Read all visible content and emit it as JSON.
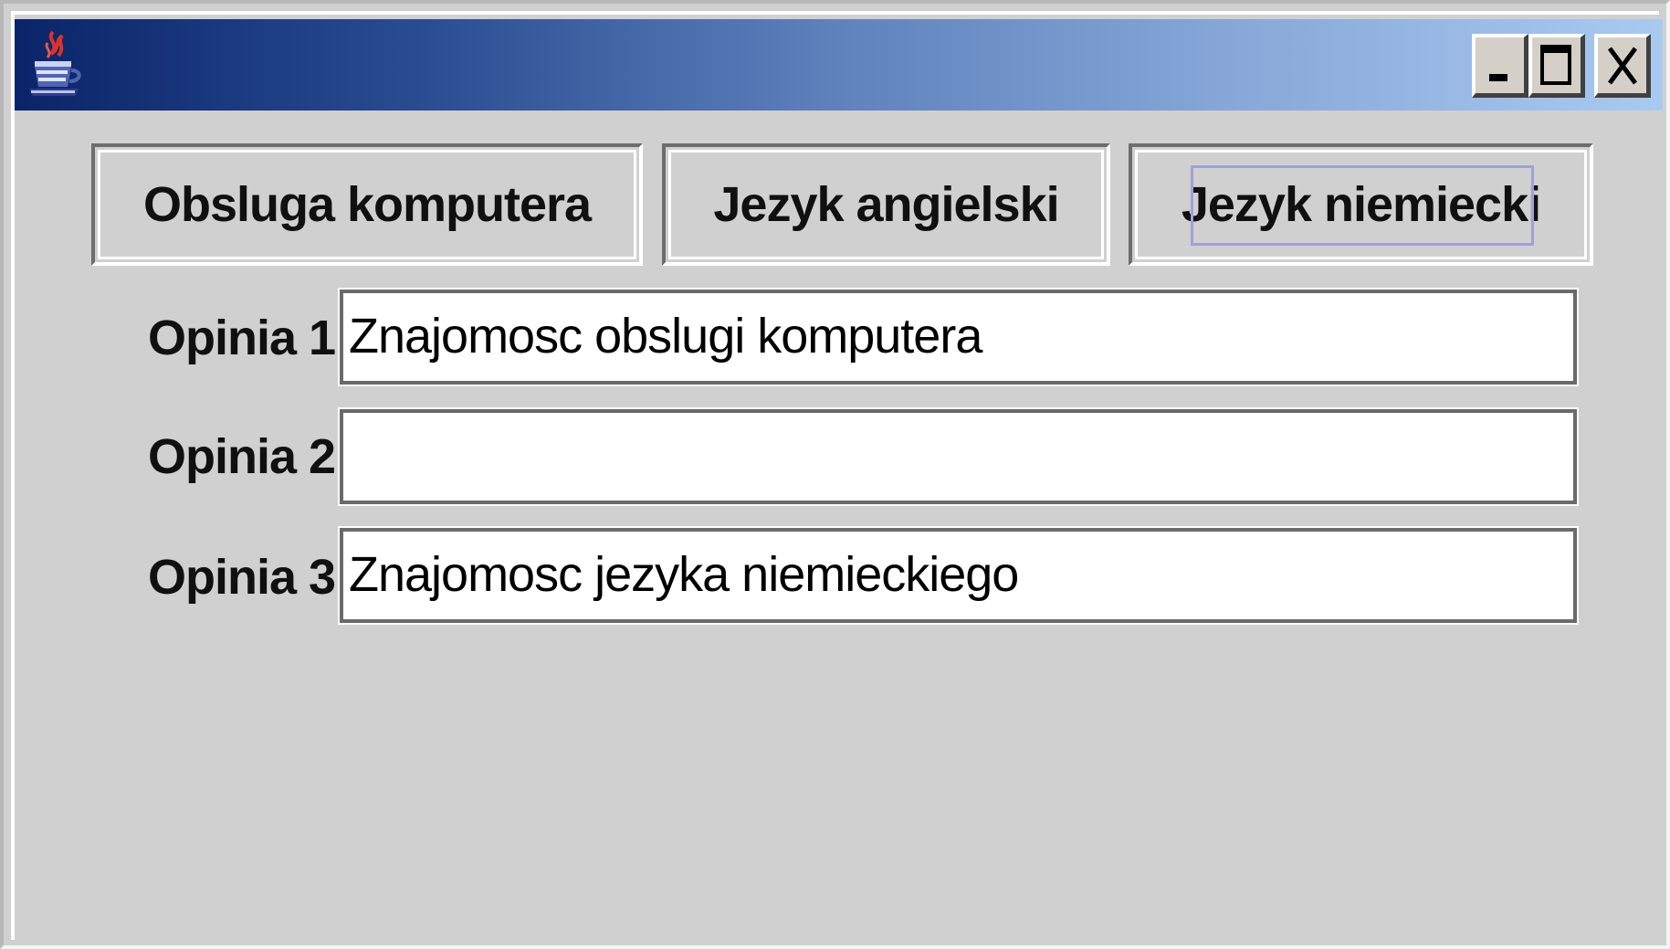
{
  "window": {
    "title": "",
    "controls": {
      "minimize_icon": "minimize-icon",
      "maximize_icon": "maximize-icon",
      "close_icon": "close-icon"
    },
    "app_icon": "java-coffee-cup-icon"
  },
  "colors": {
    "titlebar_start": "#0a2469",
    "titlebar_end": "#a9caf0",
    "window_background": "#d0d0d0",
    "focus_ring": "#9ea2d6"
  },
  "buttons": [
    {
      "label": "Obsluga komputera"
    },
    {
      "label": "Jezyk angielski"
    },
    {
      "label": "Jezyk niemiecki",
      "focused": true
    }
  ],
  "opinions": [
    {
      "label": "Opinia 1",
      "value": "Znajomosc obslugi komputera"
    },
    {
      "label": "Opinia 2",
      "value": ""
    },
    {
      "label": "Opinia 3",
      "value": "Znajomosc jezyka niemieckiego"
    }
  ]
}
